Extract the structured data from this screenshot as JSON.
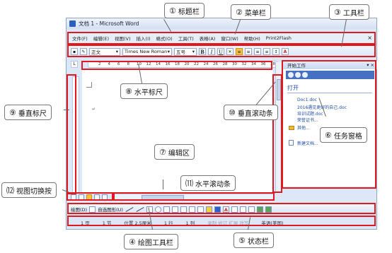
{
  "window": {
    "title": "文档 1 - Microsoft Word"
  },
  "menu": {
    "items": [
      "文件(F)",
      "编辑(E)",
      "视图(V)",
      "插入(I)",
      "格式(O)",
      "工具(T)",
      "表格(A)",
      "窗口(W)",
      "帮助(H)",
      "Print2Flash"
    ],
    "close": "×"
  },
  "toolbar": {
    "style": "正文",
    "font": "Times New Roman",
    "size": "五号",
    "bold": "B",
    "italic": "I",
    "underline": "U",
    "font_color": "A"
  },
  "ruler": {
    "ticks": [
      "2",
      "4",
      "6",
      "8",
      "10",
      "12",
      "14",
      "16",
      "18",
      "20",
      "22",
      "24",
      "26",
      "28",
      "30",
      "32",
      "34",
      "36",
      "38"
    ],
    "corner": "L"
  },
  "taskpane": {
    "title": "开始工作",
    "open_heading": "打开",
    "files": [
      "Doc1.doc",
      "2016遇见更好的自己.doc",
      "培训试题.doc",
      "荣誉证书..."
    ],
    "other": "其他...",
    "new_doc": "新建文档..."
  },
  "drawing": {
    "draw_label": "绘图(D)",
    "autoshape_label": "自选图形(U)"
  },
  "status": {
    "page": "1 页",
    "section": "1 节",
    "position": "位置 2.5厘米",
    "line": "1 行",
    "column": "1 列",
    "modes": "录制  修订  扩展  改写",
    "language": "英语(美国)"
  },
  "callouts": {
    "title_bar": {
      "num": "①",
      "label": "标题栏"
    },
    "menu_bar": {
      "num": "②",
      "label": "菜单栏"
    },
    "toolbar": {
      "num": "③",
      "label": "工具栏"
    },
    "drawing_toolbar": {
      "num": "④",
      "label": "绘图工具栏"
    },
    "status_bar": {
      "num": "⑤",
      "label": "状态栏"
    },
    "task_pane": {
      "num": "⑥",
      "label": "任务窗格"
    },
    "edit_area": {
      "num": "⑦",
      "label": "编辑区"
    },
    "h_ruler": {
      "num": "⑧",
      "label": "水平标尺"
    },
    "v_ruler": {
      "num": "⑨",
      "label": "垂直标尺"
    },
    "v_scroll": {
      "num": "⑩",
      "label": "垂直滚动条"
    },
    "h_scroll": {
      "num": "⑾",
      "label": "水平滚动条"
    },
    "view_switch": {
      "num": "⑿",
      "label": "视图切换按"
    }
  }
}
